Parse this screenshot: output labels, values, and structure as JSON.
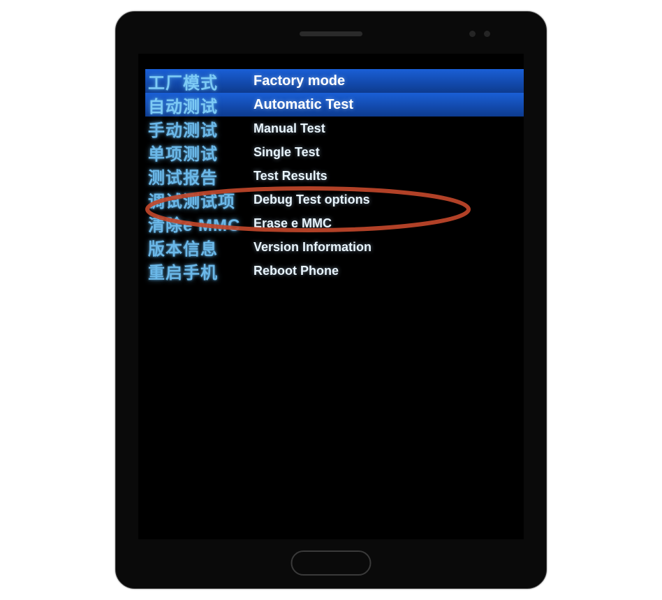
{
  "menu": {
    "items": [
      {
        "chinese": "工厂模式",
        "english": "Factory mode",
        "highlighted": true
      },
      {
        "chinese": "自动测试",
        "english": "Automatic Test",
        "highlighted": true
      },
      {
        "chinese": "手动测试",
        "english": "Manual Test",
        "highlighted": false
      },
      {
        "chinese": "单项测试",
        "english": "Single Test",
        "highlighted": false
      },
      {
        "chinese": "测试报告",
        "english": "Test Results",
        "highlighted": false
      },
      {
        "chinese": "调试测试项",
        "english": "Debug Test options",
        "highlighted": false
      },
      {
        "chinese": "清除e MMC",
        "english": "Erase e MMC",
        "highlighted": false
      },
      {
        "chinese": "版本信息",
        "english": "Version Information",
        "highlighted": false
      },
      {
        "chinese": "重启手机",
        "english": "Reboot Phone",
        "highlighted": false
      }
    ]
  },
  "annotation": {
    "circled_index": 6,
    "color": "#c0462a"
  }
}
